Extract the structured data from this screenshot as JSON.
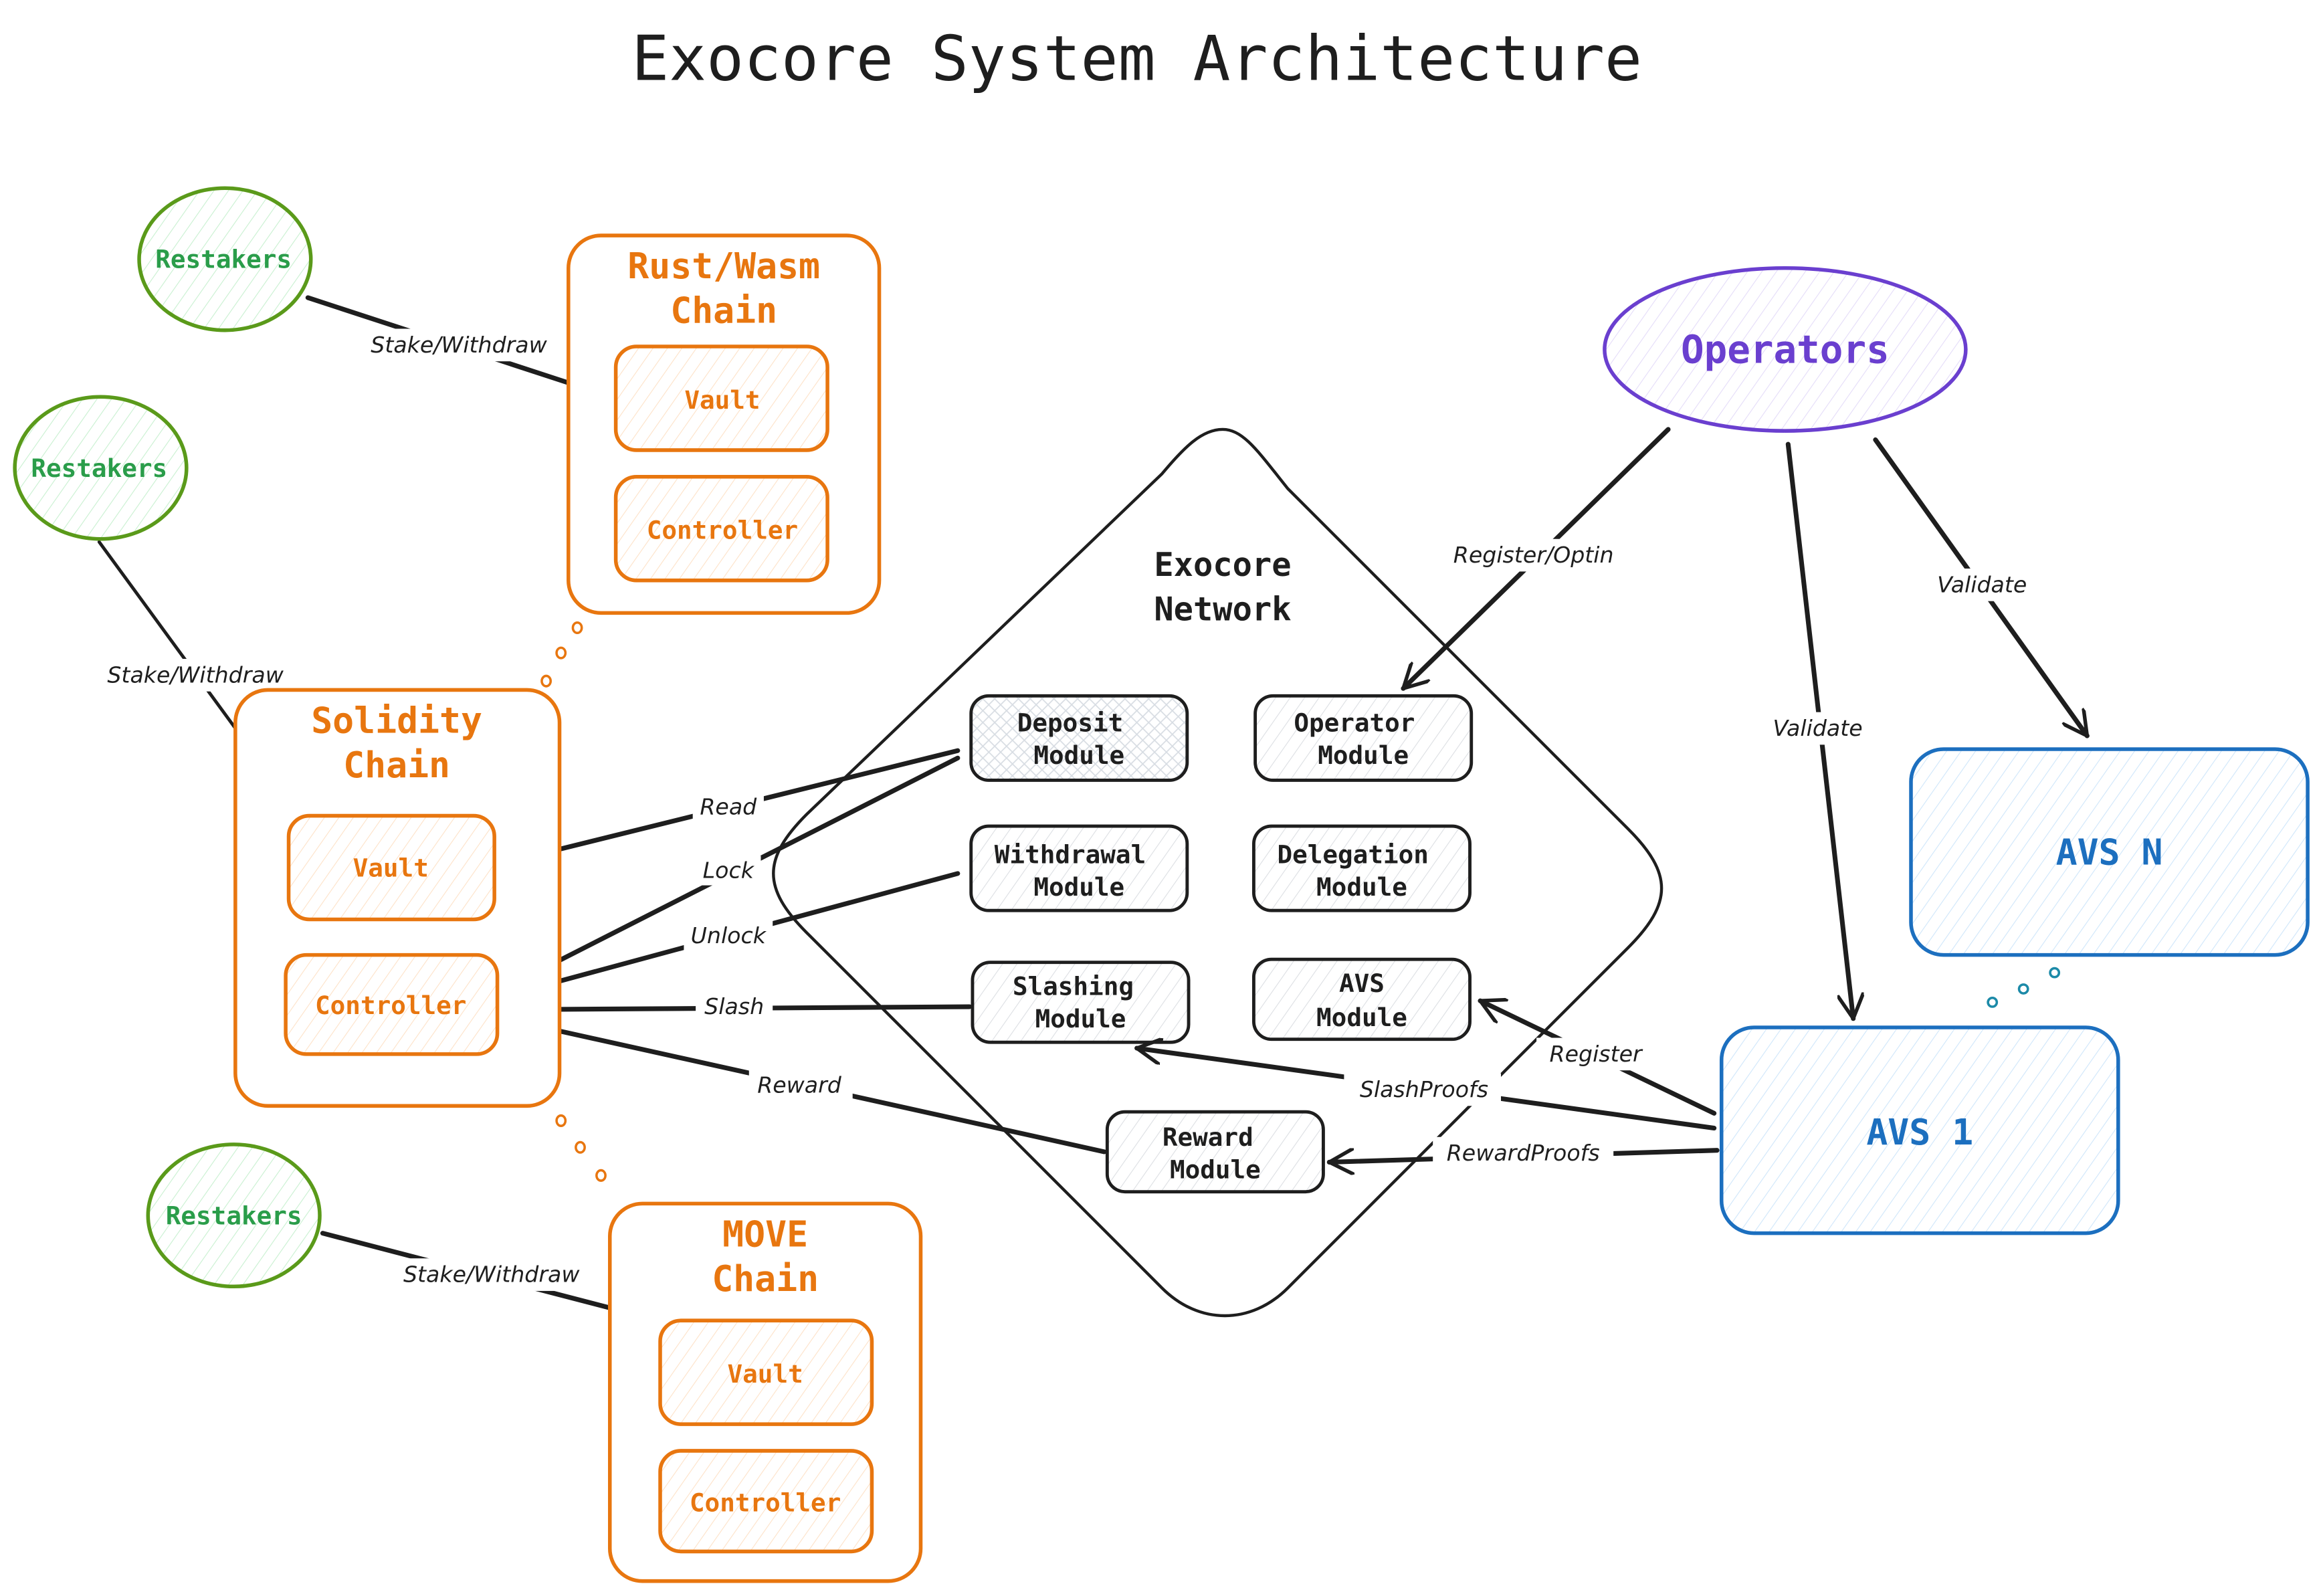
{
  "title": "Exocore System Architecture",
  "colors": {
    "chain": "#e8760f",
    "restakers": "#2a9d4a",
    "restakers_stroke": "#5a9a1a",
    "operators": "#6a3fcf",
    "avs": "#1c6fbf",
    "module": "#1e1e1e"
  },
  "restakers": [
    {
      "label": "Restakers"
    },
    {
      "label": "Restakers"
    },
    {
      "label": "Restakers"
    }
  ],
  "chains": {
    "rust": {
      "title_line1": "Rust/Wasm",
      "title_line2": "Chain",
      "vault": "Vault",
      "controller": "Controller"
    },
    "solidity": {
      "title_line1": "Solidity",
      "title_line2": "Chain",
      "vault": "Vault",
      "controller": "Controller"
    },
    "move": {
      "title_line1": "MOVE",
      "title_line2": "Chain",
      "vault": "Vault",
      "controller": "Controller"
    }
  },
  "network": {
    "title_line1": "Exocore",
    "title_line2": "Network",
    "modules": {
      "deposit": {
        "line1": "Deposit",
        "line2": "Module"
      },
      "operator": {
        "line1": "Operator",
        "line2": "Module"
      },
      "withdrawal": {
        "line1": "Withdrawal",
        "line2": "Module"
      },
      "delegation": {
        "line1": "Delegation",
        "line2": "Module"
      },
      "slashing": {
        "line1": "Slashing",
        "line2": "Module"
      },
      "avs": {
        "line1": "AVS",
        "line2": "Module"
      },
      "reward": {
        "line1": "Reward",
        "line2": "Module"
      }
    }
  },
  "operators": {
    "label": "Operators"
  },
  "avs": {
    "avs_n": {
      "label": "AVS N"
    },
    "avs_1": {
      "label": "AVS 1"
    }
  },
  "edges": {
    "stake_withdraw_1": "Stake/Withdraw",
    "stake_withdraw_2": "Stake/Withdraw",
    "stake_withdraw_3": "Stake/Withdraw",
    "read": "Read",
    "lock": "Lock",
    "unlock": "Unlock",
    "slash": "Slash",
    "reward": "Reward",
    "register_optin": "Register/Optin",
    "validate_1": "Validate",
    "validate_n": "Validate",
    "register": "Register",
    "slash_proofs": "SlashProofs",
    "reward_proofs": "RewardProofs"
  }
}
